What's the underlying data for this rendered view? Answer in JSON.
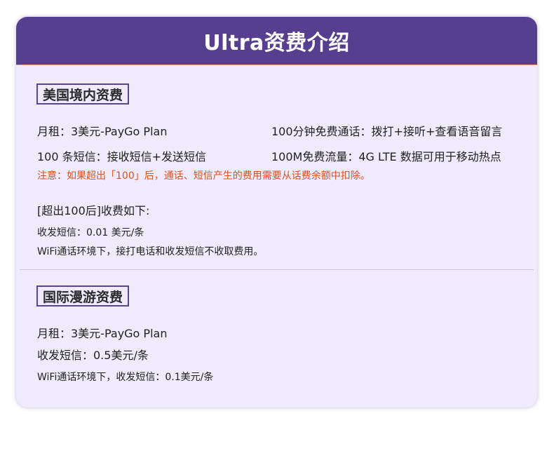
{
  "header": {
    "title": "Ultra资费介绍"
  },
  "domestic": {
    "section_title": "美国境内资费",
    "monthly_fee": "月租：3美元-PayGo Plan",
    "free_minutes": "100分钟免费通话：拨打+接听+查看语音留言",
    "sms": "100 条短信：接收短信+发送短信",
    "data": "100M免费流量：4G LTE  数据可用于移动热点",
    "notice": "注意：如果超出「100」后，通话、短信产生的费用需要从话费余额中扣除。",
    "overage_title": "[超出100后]收费如下:",
    "overage_sms": "收发短信：0.01 美元/条",
    "wifi_note": "WiFi通话环境下，接打电话和收发短信不收取费用。"
  },
  "roaming": {
    "section_title": "国际漫游资费",
    "monthly_fee": "月租：3美元-PayGo Plan",
    "sms": "收发短信：0.5美元/条",
    "wifi_note": "WiFi通话环境下，收发短信：0.1美元/条"
  },
  "colors": {
    "header_bg": "#573f8f",
    "card_bg": "#efeafc",
    "warning_text": "#d9531e",
    "section_border": "#5b4593"
  }
}
